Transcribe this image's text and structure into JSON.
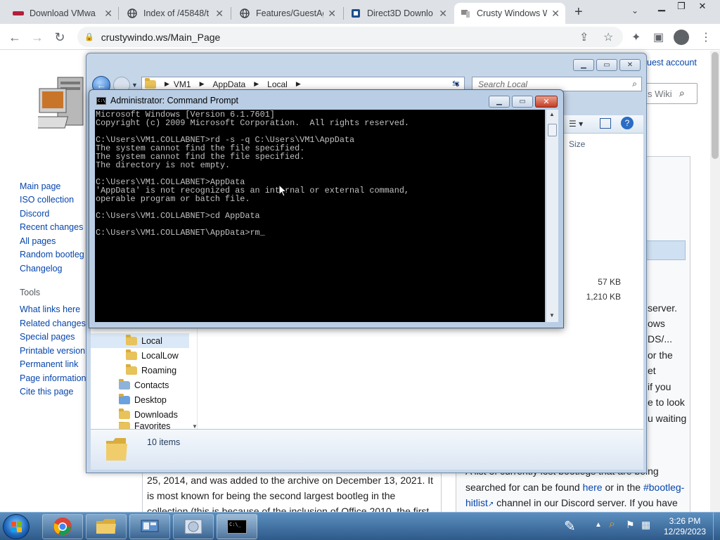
{
  "browser": {
    "tabs": [
      {
        "title": "Download VMwa",
        "icon": "vmware-icon"
      },
      {
        "title": "Index of /45848/t",
        "icon": "globe-icon"
      },
      {
        "title": "Features/GuestAg",
        "icon": "globe-icon"
      },
      {
        "title": "Direct3D Downlo",
        "icon": "page-icon"
      },
      {
        "title": "Crusty Windows W",
        "icon": "crusty-icon",
        "active": true
      }
    ],
    "url": "crustywindo.ws/Main_Page"
  },
  "webpage": {
    "top_right_link": "uest account",
    "search_partial": "s Wiki",
    "sidebar_nav": [
      "Main page",
      "ISO collection",
      "Discord",
      "Recent changes",
      "All pages",
      "Random bootleg",
      "Changelog"
    ],
    "tools_heading": "Tools",
    "sidebar_tools": [
      "What links here",
      "Related changes",
      "Special pages",
      "Printable version",
      "Permanent link",
      "Page information",
      "Cite this page"
    ],
    "right_fragments": [
      "server.",
      "ows",
      "DS/...",
      "or the",
      "et",
      "if you",
      "e to look",
      "u waiting"
    ],
    "right_bottom": {
      "line1": "A list of currently lost bootlegs that are being",
      "line2_pre": "searched for can be found ",
      "line2_link1": "here",
      "line2_mid": " or in the ",
      "line2_link2": "#bootleg-",
      "line3_link": "hitlist",
      "line3_post": " channel in our Discord server. If you have"
    },
    "left_bottom": {
      "line1": "25, 2014, and was added to the archive on December 13, 2021. It",
      "line2": "is most known for being the second largest bootleg in the",
      "line3": "collection (this is because of the inclusion of Office 2010, the first"
    }
  },
  "explorer": {
    "breadcrumb": [
      "VM1",
      "AppData",
      "Local"
    ],
    "search_placeholder": "Search Local",
    "column_size": "Size",
    "sizes": [
      "57 KB",
      "1,210 KB"
    ],
    "nav_items": [
      {
        "label": "Local",
        "selected": true
      },
      {
        "label": "LocalLow"
      },
      {
        "label": "Roaming"
      },
      {
        "label": "Contacts"
      },
      {
        "label": "Desktop"
      },
      {
        "label": "Downloads"
      },
      {
        "label": "Favorites"
      }
    ],
    "status": "10 items"
  },
  "cmd": {
    "title": "Administrator: Command Prompt",
    "lines": [
      "Microsoft Windows [Version 6.1.7601]",
      "Copyright (c) 2009 Microsoft Corporation.  All rights reserved.",
      "",
      "C:\\Users\\VM1.COLLABNET>rd -s -q C:\\Users\\VM1\\AppData",
      "The system cannot find the file specified.",
      "The system cannot find the file specified.",
      "The directory is not empty.",
      "",
      "C:\\Users\\VM1.COLLABNET>AppData",
      "'AppData' is not recognized as an internal or external command,",
      "operable program or batch file.",
      "",
      "C:\\Users\\VM1.COLLABNET>cd AppData",
      "",
      "C:\\Users\\VM1.COLLABNET\\AppData>rm_"
    ]
  },
  "taskbar": {
    "time": "3:26 PM",
    "date": "12/29/2023"
  }
}
